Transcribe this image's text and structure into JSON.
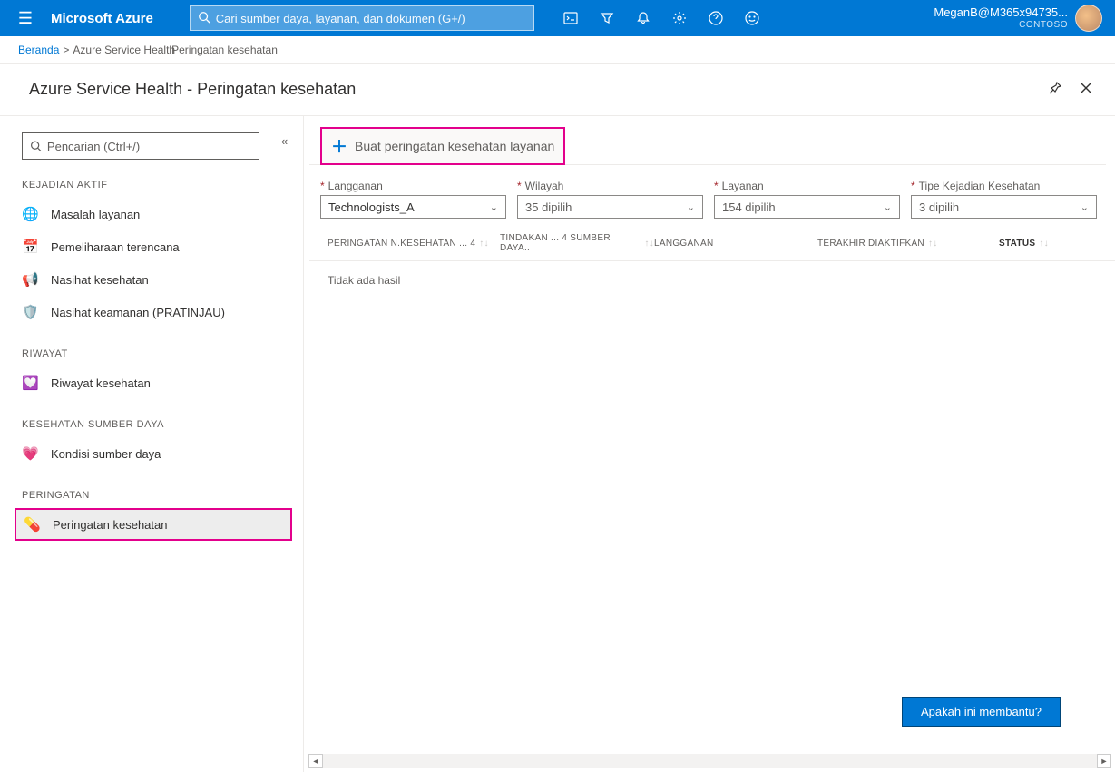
{
  "brand": "Microsoft Azure",
  "search_placeholder": "Cari sumber daya, layanan, dan dokumen (G+/)",
  "user": {
    "email": "MeganB@M365x94735...",
    "org": "CONTOSO"
  },
  "breadcrumb": {
    "home": "Beranda",
    "svc": "Azure Service Health",
    "page": "Peringatan kesehatan"
  },
  "page_title": "Azure Service Health - Peringatan kesehatan",
  "sidebar": {
    "search_placeholder": "Pencarian (Ctrl+/)",
    "sections": {
      "active": "KEJADIAN AKTIF",
      "history": "RIWAYAT",
      "resource": "KESEHATAN SUMBER DAYA",
      "alerts": "PERINGATAN"
    },
    "items": {
      "service_issues": "Masalah layanan",
      "planned_maint": "Pemeliharaan terencana",
      "health_advisory": "Nasihat kesehatan",
      "security_advisory": "Nasihat keamanan (PRATINJAU)",
      "health_history": "Riwayat kesehatan",
      "resource_health": "Kondisi sumber daya",
      "health_alerts": "Peringatan kesehatan"
    }
  },
  "command": {
    "create": "Buat peringatan kesehatan layanan"
  },
  "filters": {
    "subscription": {
      "label": "Langganan",
      "value": "Technologists_A"
    },
    "region": {
      "label": "Wilayah",
      "value": "35 dipilih"
    },
    "service": {
      "label": "Layanan",
      "value": "154 dipilih"
    },
    "event_type": {
      "label": "Tipe Kejadian Kesehatan",
      "value": "3 dipilih"
    }
  },
  "table": {
    "col1": "PERINGATAN N.KESEHATAN ... 4",
    "col2": "TINDAKAN ... 4 SUMBER DAYA..",
    "col3": "LANGGANAN",
    "col4": "TERAKHIR DIAKTIFKAN",
    "col5": "STATUS",
    "empty": "Tidak ada hasil"
  },
  "help_button": "Apakah ini membantu?"
}
